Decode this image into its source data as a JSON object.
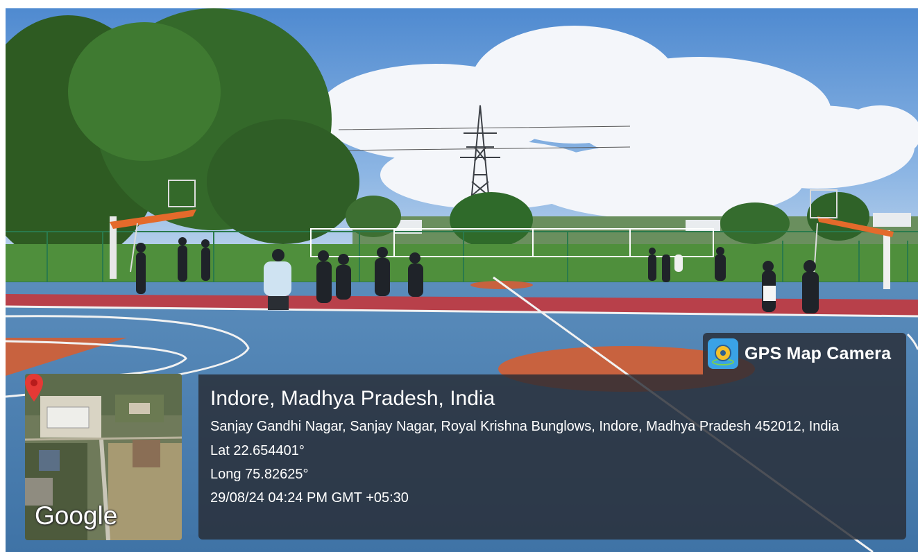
{
  "overlay": {
    "brand": {
      "app_name": "GPS Map Camera",
      "icon": "gps-map-camera-app-icon"
    },
    "map": {
      "provider_logo": "Google",
      "pin_icon": "map-pin-icon",
      "pin_color": "#e53935"
    },
    "location": {
      "title": "Indore, Madhya Pradesh, India",
      "address": "Sanjay Gandhi Nagar, Sanjay Nagar, Royal Krishna Bunglows, Indore, Madhya Pradesh 452012, India",
      "latitude": "Lat 22.654401°",
      "longitude": "Long 75.82625°",
      "timestamp": "29/08/24 04:24 PM GMT +05:30"
    }
  },
  "colors": {
    "panel_background": "rgba(40,44,52,0.82)",
    "court_blue": "#4a7fb0",
    "court_orange": "#c8623f",
    "court_red": "#b8404a",
    "sky_blue": "#5f97d4"
  }
}
